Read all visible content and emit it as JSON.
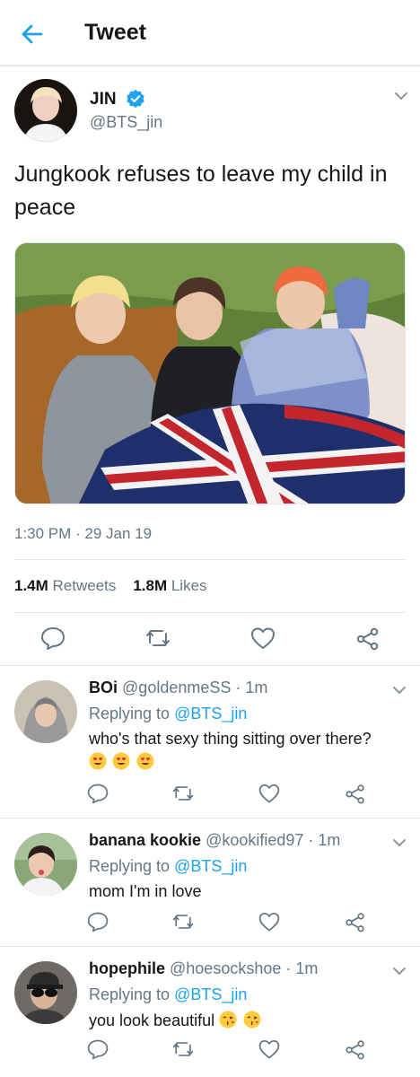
{
  "header": {
    "title": "Tweet"
  },
  "tweet": {
    "author_name": "JIN",
    "author_handle": "@BTS_jin",
    "text": "Jungkook refuses to leave my child in peace",
    "timestamp": "1:30 PM · 29 Jan 19",
    "retweets_count": "1.4M",
    "retweets_label": "Retweets",
    "likes_count": "1.8M",
    "likes_label": "Likes"
  },
  "replies": [
    {
      "name": "BOi",
      "handle": "@goldenmeSS",
      "time": "· 1m",
      "replying_prefix": "Replying to",
      "replying_to": "@BTS_jin",
      "text": "who's that sexy thing sitting over there?",
      "emojis": [
        "heart-eyes",
        "heart-eyes",
        "heart-eyes"
      ]
    },
    {
      "name": "banana kookie",
      "handle": "@kookified97",
      "time": "· 1m",
      "replying_prefix": "Replying to",
      "replying_to": "@BTS_jin",
      "text": "mom I'm in love",
      "emojis": []
    },
    {
      "name": "hopephile",
      "handle": "@hoesockshoe",
      "time": "· 1m",
      "replying_prefix": "Replying to",
      "replying_to": "@BTS_jin",
      "text": "you look beautiful",
      "emojis": [
        "kissing-heart",
        "kissing-heart"
      ]
    }
  ],
  "colors": {
    "accent": "#1da1f2",
    "text": "#14171a",
    "secondary": "#657786",
    "divider": "#e1e8ed"
  }
}
